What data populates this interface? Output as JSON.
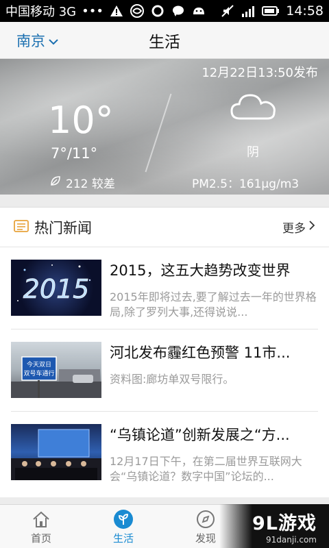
{
  "status": {
    "carrier": "中国移动 3G",
    "dots": "•••",
    "signal_label": "3G",
    "time": "14:58"
  },
  "header": {
    "city": "南京",
    "title": "生活"
  },
  "weather": {
    "publish_time": "12月22日13:50发布",
    "temperature": "10°",
    "range": "7°/11°",
    "aqi": "212 较差",
    "condition": "阴",
    "pm25": "PM2.5：161μg/m3"
  },
  "news": {
    "section_title": "热门新闻",
    "more_label": "更多",
    "items": [
      {
        "title": "2015，这五大趋势改变世界",
        "desc": "2015年即将过去,要了解过去一年的世界格局,除了罗列大事,还得说说...",
        "thumb_text": "2015"
      },
      {
        "title": "河北发布霾红色预警 11市...",
        "desc": "资料图:廊坊单双号限行。",
        "thumb_text": "今天双日\n双号车通行"
      },
      {
        "title": "“乌镇论道”创新发展之“方...",
        "desc": "12月17日下午，在第二届世界互联网大会“乌镇论道？数字中国”论坛的...",
        "thumb_text": ""
      }
    ]
  },
  "nav": {
    "tabs": [
      {
        "label": "首页",
        "icon": "home-icon"
      },
      {
        "label": "生活",
        "icon": "leaf-icon"
      },
      {
        "label": "发现",
        "icon": "compass-icon"
      }
    ]
  },
  "watermark": {
    "main": "9L游戏",
    "sub": "91danji.com"
  },
  "colors": {
    "accent": "#1a8bd2",
    "city": "#1a6fb0"
  }
}
